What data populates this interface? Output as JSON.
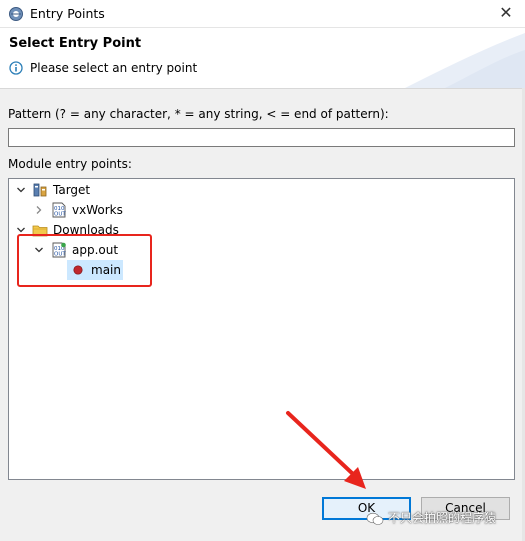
{
  "window": {
    "title": "Entry Points",
    "close_glyph": "✕"
  },
  "header": {
    "title": "Select Entry Point",
    "message": "Please select an entry point",
    "icon": "info-icon"
  },
  "pattern": {
    "label": "Pattern (? = any character, * = any string, < = end of pattern):",
    "value": ""
  },
  "module": {
    "label": "Module entry points:",
    "tree": [
      {
        "label": "Target",
        "icon": "target-icon",
        "expanded": true
      },
      {
        "label": "vxWorks",
        "icon": "object-file-icon",
        "expanded": false
      },
      {
        "label": "Downloads",
        "icon": "folder-icon",
        "expanded": true
      },
      {
        "label": "app.out",
        "icon": "object-file-icon",
        "expanded": true
      },
      {
        "label": "main",
        "icon": "function-dot-icon",
        "selected": true
      }
    ]
  },
  "buttons": {
    "ok": "OK",
    "cancel": "Cancel"
  },
  "watermark": {
    "text": "不只会拍照的程序猿"
  },
  "colors": {
    "selection": "#cce8ff",
    "annotation_red": "#e8251d",
    "default_button_border": "#0078d7",
    "function_dot": "#c0282d"
  }
}
